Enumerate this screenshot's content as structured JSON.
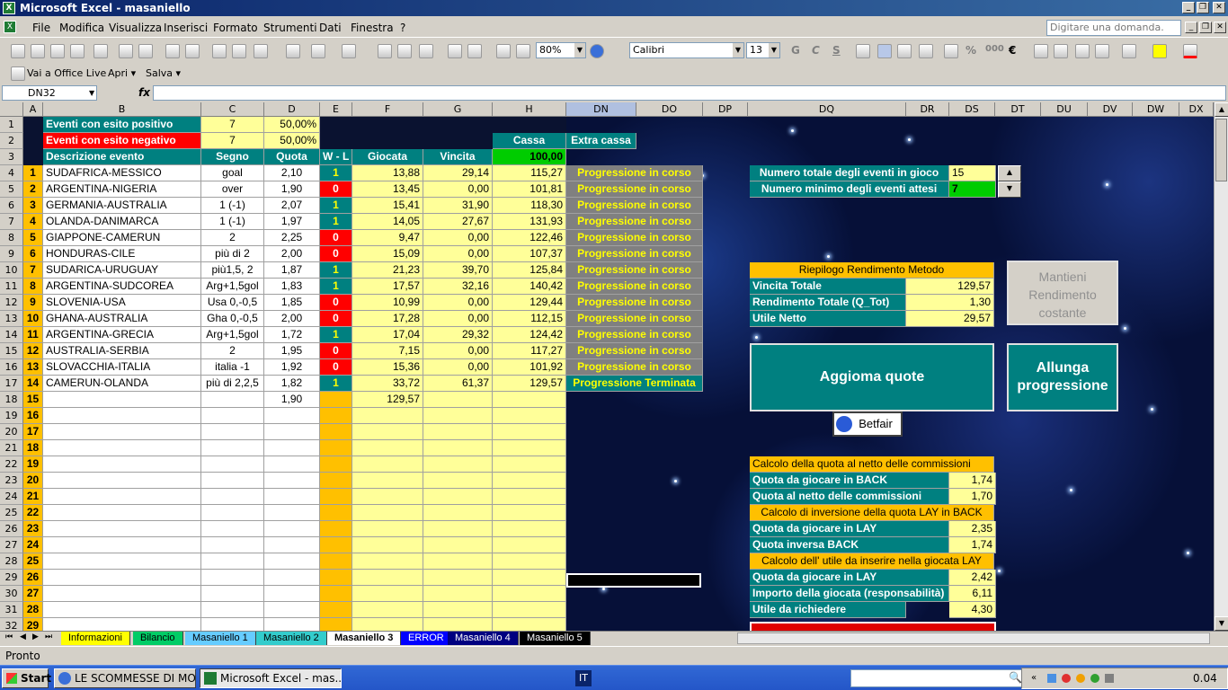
{
  "window": {
    "title": "Microsoft Excel - masaniello",
    "app_icon": "excel-icon"
  },
  "menu": {
    "items": [
      "File",
      "Modifica",
      "Visualizza",
      "Inserisci",
      "Formato",
      "Strumenti",
      "Dati",
      "Finestra",
      "?"
    ],
    "ask_placeholder": "Digitare una domanda."
  },
  "toolbar": {
    "zoom": "80%",
    "font_name": "Calibri",
    "font_size": "13",
    "office_live": "Vai a Office Live",
    "open": "Apri ▾",
    "save": "Salva ▾",
    "bold": "G",
    "italic": "C",
    "underline": "S",
    "percent": "%",
    "thousands": "000",
    "euro": "€"
  },
  "formula": {
    "name_box": "DN32",
    "fx": "fx",
    "value": ""
  },
  "columns": [
    "A",
    "B",
    "C",
    "D",
    "E",
    "F",
    "G",
    "H",
    "DN",
    "DO",
    "DP",
    "DQ",
    "DR",
    "DS",
    "DT",
    "DU",
    "DV",
    "DW",
    "DX"
  ],
  "rows": [
    "1",
    "2",
    "3",
    "4",
    "5",
    "6",
    "7",
    "8",
    "9",
    "10",
    "11",
    "12",
    "13",
    "14",
    "15",
    "16",
    "17",
    "18",
    "19",
    "20",
    "21",
    "22",
    "23",
    "24",
    "25",
    "26",
    "27",
    "28",
    "29",
    "30",
    "31",
    "32"
  ],
  "header": {
    "pos_label": "Eventi con esito positivo",
    "pos_count": "7",
    "pos_pct": "50,00%",
    "neg_label": "Eventi con esito negativo",
    "neg_count": "7",
    "neg_pct": "50,00%",
    "cassa": "Cassa",
    "extra_cassa": "Extra cassa",
    "cassa_value": "100,00",
    "col_desc": "Descrizione evento",
    "col_segno": "Segno",
    "col_quota": "Quota",
    "col_wl": "W - L",
    "col_giocata": "Giocata",
    "col_vincita": "Vincita"
  },
  "events": [
    {
      "n": "1",
      "desc": "SUDAFRICA-MESSICO",
      "segno": "goal",
      "quota": "2,10",
      "wl": "1",
      "giocata": "13,88",
      "vincita": "29,14",
      "cassa": "115,27",
      "status": "Progressione in corso"
    },
    {
      "n": "2",
      "desc": "ARGENTINA-NIGERIA",
      "segno": "over",
      "quota": "1,90",
      "wl": "0",
      "giocata": "13,45",
      "vincita": "0,00",
      "cassa": "101,81",
      "status": "Progressione in corso"
    },
    {
      "n": "3",
      "desc": "GERMANIA-AUSTRALIA",
      "segno": "1 (-1)",
      "quota": "2,07",
      "wl": "1",
      "giocata": "15,41",
      "vincita": "31,90",
      "cassa": "118,30",
      "status": "Progressione in corso"
    },
    {
      "n": "4",
      "desc": "OLANDA-DANIMARCA",
      "segno": "1 (-1)",
      "quota": "1,97",
      "wl": "1",
      "giocata": "14,05",
      "vincita": "27,67",
      "cassa": "131,93",
      "status": "Progressione in corso"
    },
    {
      "n": "5",
      "desc": "GIAPPONE-CAMERUN",
      "segno": "2",
      "quota": "2,25",
      "wl": "0",
      "giocata": "9,47",
      "vincita": "0,00",
      "cassa": "122,46",
      "status": "Progressione in corso"
    },
    {
      "n": "6",
      "desc": "HONDURAS-CILE",
      "segno": "più di 2",
      "quota": "2,00",
      "wl": "0",
      "giocata": "15,09",
      "vincita": "0,00",
      "cassa": "107,37",
      "status": "Progressione in corso"
    },
    {
      "n": "7",
      "desc": "SUDARICA-URUGUAY",
      "segno": "più1,5, 2",
      "quota": "1,87",
      "wl": "1",
      "giocata": "21,23",
      "vincita": "39,70",
      "cassa": "125,84",
      "status": "Progressione in corso"
    },
    {
      "n": "8",
      "desc": "ARGENTINA-SUDCOREA",
      "segno": "Arg+1,5gol",
      "quota": "1,83",
      "wl": "1",
      "giocata": "17,57",
      "vincita": "32,16",
      "cassa": "140,42",
      "status": "Progressione in corso"
    },
    {
      "n": "9",
      "desc": "SLOVENIA-USA",
      "segno": "Usa 0,-0,5",
      "quota": "1,85",
      "wl": "0",
      "giocata": "10,99",
      "vincita": "0,00",
      "cassa": "129,44",
      "status": "Progressione in corso"
    },
    {
      "n": "10",
      "desc": "GHANA-AUSTRALIA",
      "segno": "Gha 0,-0,5",
      "quota": "2,00",
      "wl": "0",
      "giocata": "17,28",
      "vincita": "0,00",
      "cassa": "112,15",
      "status": "Progressione in corso"
    },
    {
      "n": "11",
      "desc": "ARGENTINA-GRECIA",
      "segno": "Arg+1,5gol",
      "quota": "1,72",
      "wl": "1",
      "giocata": "17,04",
      "vincita": "29,32",
      "cassa": "124,42",
      "status": "Progressione in corso"
    },
    {
      "n": "12",
      "desc": "AUSTRALIA-SERBIA",
      "segno": "2",
      "quota": "1,95",
      "wl": "0",
      "giocata": "7,15",
      "vincita": "0,00",
      "cassa": "117,27",
      "status": "Progressione in corso"
    },
    {
      "n": "13",
      "desc": "SLOVACCHIA-ITALIA",
      "segno": "italia -1",
      "quota": "1,92",
      "wl": "0",
      "giocata": "15,36",
      "vincita": "0,00",
      "cassa": "101,92",
      "status": "Progressione in corso"
    },
    {
      "n": "14",
      "desc": "CAMERUN-OLANDA",
      "segno": "più di 2,2,5",
      "quota": "1,82",
      "wl": "1",
      "giocata": "33,72",
      "vincita": "61,37",
      "cassa": "129,57",
      "status": "Progressione Terminata"
    },
    {
      "n": "15",
      "desc": "",
      "segno": "",
      "quota": "1,90",
      "wl": "",
      "giocata": "129,57",
      "vincita": "",
      "cassa": "",
      "status": ""
    },
    {
      "n": "16"
    },
    {
      "n": "17"
    },
    {
      "n": "18"
    },
    {
      "n": "19"
    },
    {
      "n": "20"
    },
    {
      "n": "21"
    },
    {
      "n": "22"
    },
    {
      "n": "23"
    },
    {
      "n": "24"
    },
    {
      "n": "25"
    },
    {
      "n": "26"
    },
    {
      "n": "27"
    },
    {
      "n": "28"
    },
    {
      "n": "29"
    }
  ],
  "panel": {
    "tot_label": "Numero totale degli eventi in gioco",
    "tot_value": "15",
    "min_label": "Numero minimo degli eventi attesi",
    "min_value": "7",
    "riepilogo": "Riepilogo Rendimento Metodo",
    "vincita_label": "Vincita Totale",
    "vincita_value": "129,57",
    "rend_label": "Rendimento Totale  (Q_Tot)",
    "rend_value": "1,30",
    "utile_label": "Utile Netto",
    "utile_value": "29,57",
    "mantieni": "Mantieni Rendimento costante",
    "aggiorna": "Aggioma quote",
    "allunga": "Allunga progressione",
    "betfair": "Betfair",
    "calc1": "Calcolo della quota al netto delle commissioni",
    "back_label": "Quota da giocare in BACK",
    "back_value": "1,74",
    "netto_label": "Quota al netto delle commissioni",
    "netto_value": "1,70",
    "calc2": "Calcolo di inversione della quota LAY in BACK",
    "lay_label": "Quota da giocare in LAY",
    "lay_value": "2,35",
    "inv_label": "Quota inversa  BACK",
    "inv_value": "1,74",
    "calc3": "Calcolo dell' utile da inserire nella giocata LAY",
    "lay2_label": "Quota da giocare in LAY",
    "lay2_value": "2,42",
    "imp_label": "Importo della giocata (responsabilità)",
    "imp_value": "6,11",
    "ric_label": "Utile da richiedere",
    "ric_value": "4,30"
  },
  "sheets": [
    "Informazioni",
    "Bilancio",
    "Masaniello 1",
    "Masaniello 2",
    "Masaniello 3",
    "ERROR",
    "Masaniello 4",
    "Masaniello 5"
  ],
  "status": "Pronto",
  "taskbar": {
    "start": "Start",
    "task1": "LE SCOMMESSE DI MOG...",
    "task2": "Microsoft Excel - mas...",
    "lang": "IT",
    "clock": "0.04"
  }
}
